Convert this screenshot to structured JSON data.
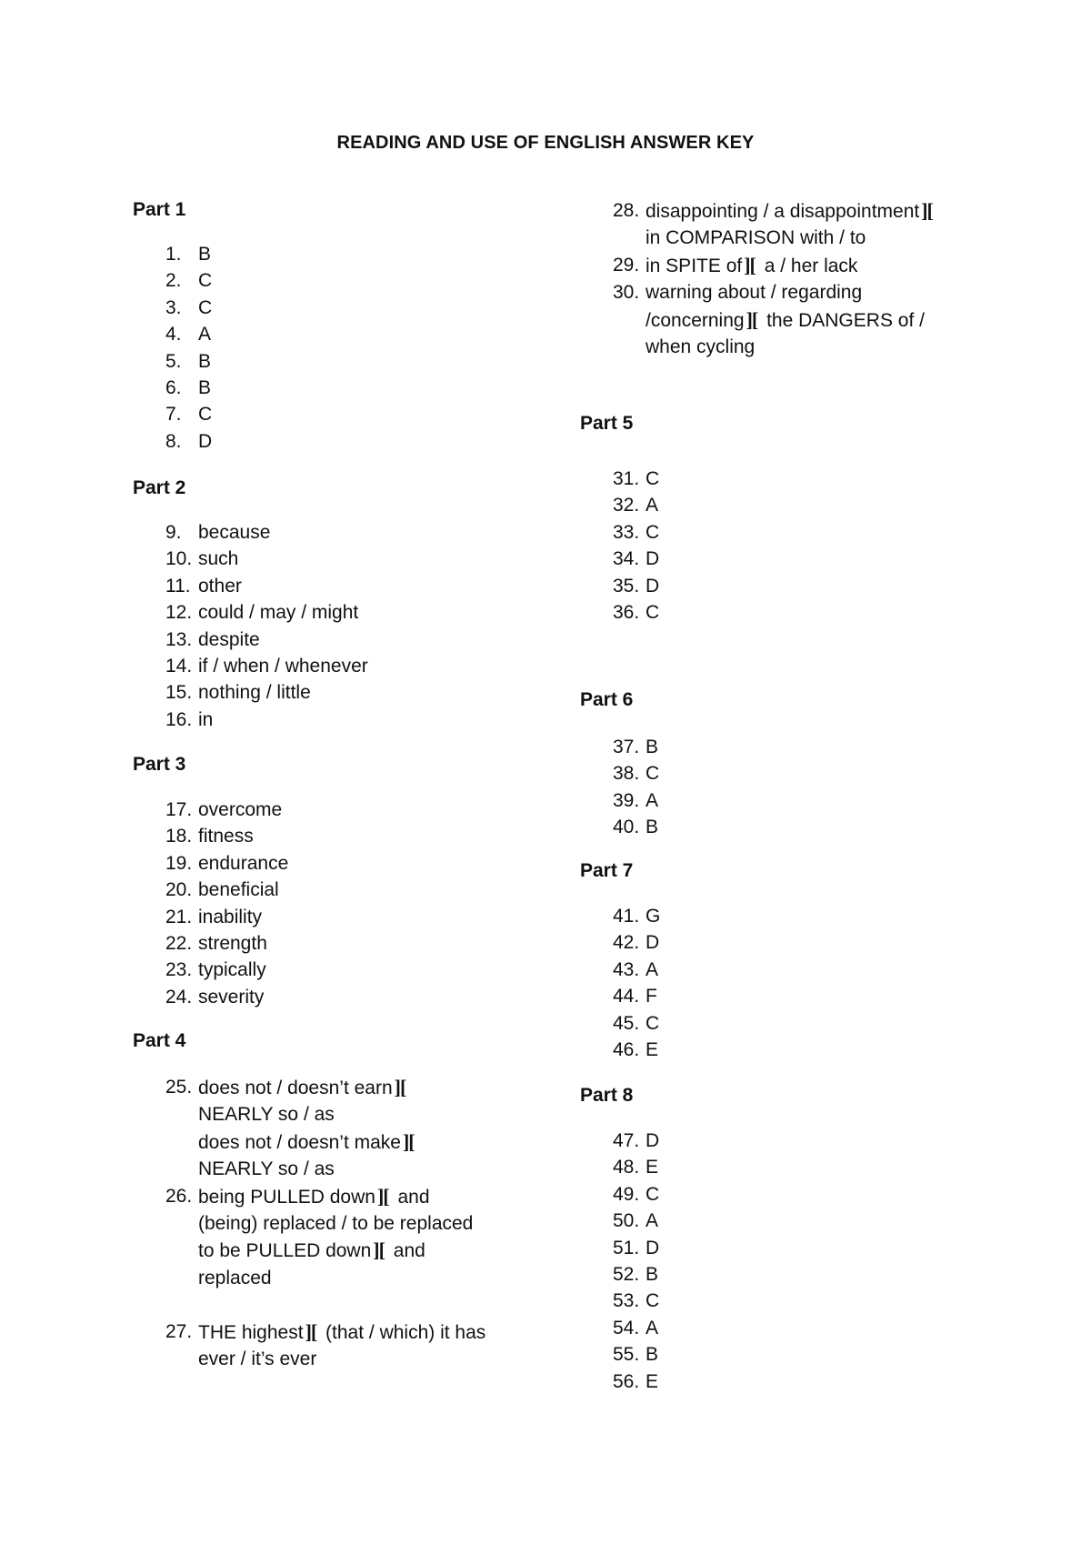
{
  "document": {
    "title": "READING AND USE OF ENGLISH ANSWER KEY",
    "separator": "][",
    "parts": [
      {
        "heading": "Part 1",
        "answers": [
          {
            "num": "1.",
            "lines": [
              "B"
            ]
          },
          {
            "num": "2.",
            "lines": [
              "C"
            ]
          },
          {
            "num": "3.",
            "lines": [
              "C"
            ]
          },
          {
            "num": "4.",
            "lines": [
              "A"
            ]
          },
          {
            "num": "5.",
            "lines": [
              "B"
            ]
          },
          {
            "num": "6.",
            "lines": [
              "B"
            ]
          },
          {
            "num": "7.",
            "lines": [
              "C"
            ]
          },
          {
            "num": "8.",
            "lines": [
              "D"
            ]
          }
        ]
      },
      {
        "heading": "Part 2",
        "answers": [
          {
            "num": "9.",
            "lines": [
              "because"
            ]
          },
          {
            "num": "10.",
            "lines": [
              "such"
            ]
          },
          {
            "num": "11.",
            "lines": [
              "other"
            ]
          },
          {
            "num": "12.",
            "lines": [
              "could / may / might"
            ]
          },
          {
            "num": "13.",
            "lines": [
              "despite"
            ]
          },
          {
            "num": "14.",
            "lines": [
              "if / when / whenever"
            ]
          },
          {
            "num": "15.",
            "lines": [
              "nothing / little"
            ]
          },
          {
            "num": "16.",
            "lines": [
              "in"
            ]
          }
        ]
      },
      {
        "heading": "Part 3",
        "answers": [
          {
            "num": "17.",
            "lines": [
              "overcome"
            ]
          },
          {
            "num": "18.",
            "lines": [
              "fitness"
            ]
          },
          {
            "num": "19.",
            "lines": [
              "endurance"
            ]
          },
          {
            "num": "20.",
            "lines": [
              "beneficial"
            ]
          },
          {
            "num": "21.",
            "lines": [
              "inability"
            ]
          },
          {
            "num": "22.",
            "lines": [
              "strength"
            ]
          },
          {
            "num": "23.",
            "lines": [
              "typically"
            ]
          },
          {
            "num": "24.",
            "lines": [
              "severity"
            ]
          }
        ]
      },
      {
        "heading": "Part 4",
        "answers": [
          {
            "num": "25.",
            "lines": [
              [
                "does not / doesn’t earn",
                "]["
              ],
              [
                "NEARLY so / as"
              ],
              [
                "does not / doesn’t make",
                "]["
              ],
              [
                "NEARLY so / as"
              ]
            ]
          },
          {
            "num": "26.",
            "lines": [
              [
                "being PULLED down",
                "][",
                " and"
              ],
              [
                "(being) replaced / to be replaced"
              ],
              [
                "to be PULLED down",
                "][",
                " and"
              ],
              [
                "replaced"
              ]
            ]
          },
          {
            "num": "27.",
            "lines": [
              [
                "THE highest",
                "][",
                " (that / which) it has"
              ],
              [
                "ever / it’s ever"
              ]
            ]
          },
          {
            "num": "28.",
            "lines": [
              [
                "disappointing / a disappointment",
                "]["
              ],
              [
                "in COMPARISON with / to"
              ]
            ]
          },
          {
            "num": "29.",
            "lines": [
              [
                "in SPITE of",
                "][",
                " a / her lack"
              ]
            ]
          },
          {
            "num": "30.",
            "lines": [
              [
                "warning about / regarding"
              ],
              [
                "/concerning",
                "][",
                " the DANGERS of /"
              ],
              [
                "when cycling"
              ]
            ]
          }
        ]
      },
      {
        "heading": "Part 5",
        "answers": [
          {
            "num": "31.",
            "lines": [
              "C"
            ]
          },
          {
            "num": "32.",
            "lines": [
              "A"
            ]
          },
          {
            "num": "33.",
            "lines": [
              "C"
            ]
          },
          {
            "num": "34.",
            "lines": [
              "D"
            ]
          },
          {
            "num": "35.",
            "lines": [
              "D"
            ]
          },
          {
            "num": "36.",
            "lines": [
              "C"
            ]
          }
        ]
      },
      {
        "heading": "Part 6",
        "answers": [
          {
            "num": "37.",
            "lines": [
              "B"
            ]
          },
          {
            "num": "38.",
            "lines": [
              "C"
            ]
          },
          {
            "num": "39.",
            "lines": [
              "A"
            ]
          },
          {
            "num": "40.",
            "lines": [
              "B"
            ]
          }
        ]
      },
      {
        "heading": "Part 7",
        "answers": [
          {
            "num": "41.",
            "lines": [
              "G"
            ]
          },
          {
            "num": "42.",
            "lines": [
              "D"
            ]
          },
          {
            "num": "43.",
            "lines": [
              "A"
            ]
          },
          {
            "num": "44.",
            "lines": [
              "F"
            ]
          },
          {
            "num": "45.",
            "lines": [
              "C"
            ]
          },
          {
            "num": "46.",
            "lines": [
              "E"
            ]
          }
        ]
      },
      {
        "heading": "Part 8",
        "answers": [
          {
            "num": "47.",
            "lines": [
              "D"
            ]
          },
          {
            "num": "48.",
            "lines": [
              "E"
            ]
          },
          {
            "num": "49.",
            "lines": [
              "C"
            ]
          },
          {
            "num": "50.",
            "lines": [
              "A"
            ]
          },
          {
            "num": "51.",
            "lines": [
              "D"
            ]
          },
          {
            "num": "52.",
            "lines": [
              "B"
            ]
          },
          {
            "num": "53.",
            "lines": [
              "C"
            ]
          },
          {
            "num": "54.",
            "lines": [
              "A"
            ]
          },
          {
            "num": "55.",
            "lines": [
              "B"
            ]
          },
          {
            "num": "56.",
            "lines": [
              "E"
            ]
          }
        ]
      }
    ]
  }
}
